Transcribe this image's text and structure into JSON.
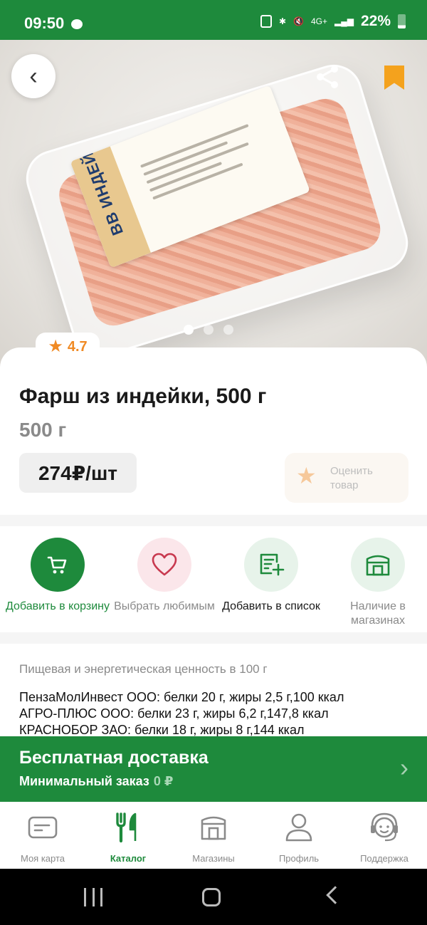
{
  "status_bar": {
    "time": "09:50",
    "network": "4G+",
    "battery": "22%"
  },
  "product": {
    "package_label": "ИНДЕЙКА",
    "package_brand": "ВВ",
    "rating": "4.7",
    "title": "Фарш из индейки, 500 г",
    "weight": "500 г",
    "price": "274₽/шт",
    "rate_label": "Оценить товар",
    "gallery": {
      "current": 1,
      "total": 3
    }
  },
  "actions": [
    {
      "label": "Добавить в корзину",
      "icon": "cart-icon",
      "color": "#1e8a3c"
    },
    {
      "label": "Выбрать любимым",
      "icon": "heart-icon",
      "color": "#c8394f"
    },
    {
      "label": "Добавить в список",
      "icon": "list-add-icon",
      "color": "#1e8a3c"
    },
    {
      "label": "Наличие в магазинах",
      "icon": "store-icon",
      "color": "#1e8a3c"
    }
  ],
  "nutrition": {
    "title": "Пищевая и энергетическая ценность в 100 г",
    "lines": [
      "ПензаМолИнвест ООО: белки 20 г, жиры 2,5 г,100 ккал",
      "АГРО-ПЛЮС ООО: белки 23 г, жиры 6,2 г,147,8 ккал",
      "КРАСНОБОР ЗАО: белки 18 г, жиры 8 г,144 ккал"
    ]
  },
  "delivery": {
    "title": "Бесплатная доставка",
    "min_order_label": "Минимальный заказ",
    "min_order_value": "0 ₽"
  },
  "bottom_nav": [
    {
      "label": "Моя карта",
      "icon": "card-icon",
      "active": false
    },
    {
      "label": "Каталог",
      "icon": "cutlery-icon",
      "active": true
    },
    {
      "label": "Магазины",
      "icon": "store-icon",
      "active": false
    },
    {
      "label": "Профиль",
      "icon": "profile-icon",
      "active": false
    },
    {
      "label": "Поддержка",
      "icon": "support-icon",
      "active": false
    }
  ],
  "colors": {
    "brand_green": "#1e8a3c",
    "accent_orange": "#f08a24",
    "bookmark_orange": "#f4a21d",
    "muted_text": "#8a8a8a"
  }
}
